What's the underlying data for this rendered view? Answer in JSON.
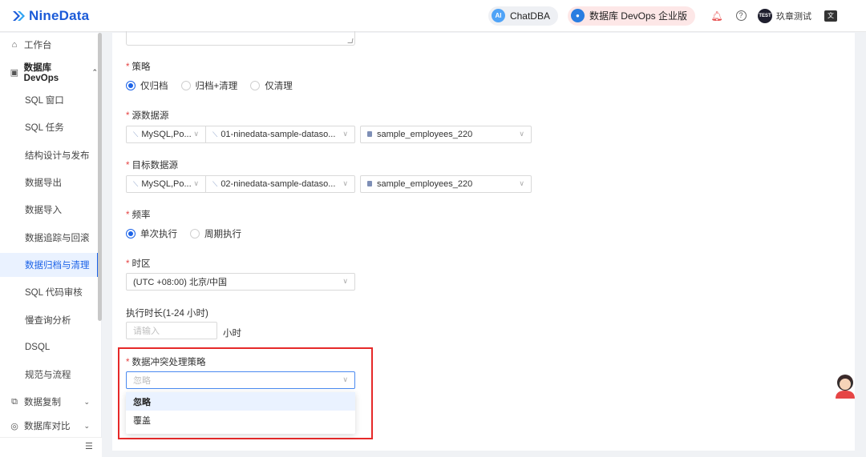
{
  "header": {
    "logo_text": "NineData",
    "chatdba_label": "ChatDBA",
    "devops_label": "数据库 DevOps 企业版",
    "avatar_text": "TEST",
    "username": "玖章测试",
    "brand_color": "#1c5bd8",
    "accent_color": "#1c63e8"
  },
  "sidebar": {
    "workbench": "工作台",
    "devops": "数据库 DevOps",
    "sub_items": [
      "SQL 窗口",
      "SQL 任务",
      "结构设计与发布",
      "数据导出",
      "数据导入",
      "数据追踪与回滚",
      "数据归档与清理",
      "SQL 代码审核",
      "慢查询分析",
      "DSQL",
      "规范与流程"
    ],
    "active_item": "数据归档与清理",
    "replication": "数据复制",
    "compare": "数据库对比"
  },
  "form": {
    "strategy": {
      "label": "策略",
      "options": [
        "仅归档",
        "归档+清理",
        "仅清理"
      ],
      "selected": "仅归档"
    },
    "source": {
      "label": "源数据源",
      "type": "MySQL,Po...",
      "datasource": "01-ninedata-sample-dataso...",
      "database": "sample_employees_220"
    },
    "target": {
      "label": "目标数据源",
      "type": "MySQL,Po...",
      "datasource": "02-ninedata-sample-dataso...",
      "database": "sample_employees_220"
    },
    "frequency": {
      "label": "频率",
      "options": [
        "单次执行",
        "周期执行"
      ],
      "selected": "单次执行"
    },
    "timezone": {
      "label": "时区",
      "value": "(UTC +08:00) 北京/中国"
    },
    "duration": {
      "label": "执行时长(1-24 小时)",
      "placeholder": "请输入",
      "unit": "小时"
    },
    "conflict": {
      "label": "数据冲突处理策略",
      "placeholder": "忽略",
      "options": [
        "忽略",
        "覆盖"
      ],
      "highlighted": "忽略"
    }
  }
}
